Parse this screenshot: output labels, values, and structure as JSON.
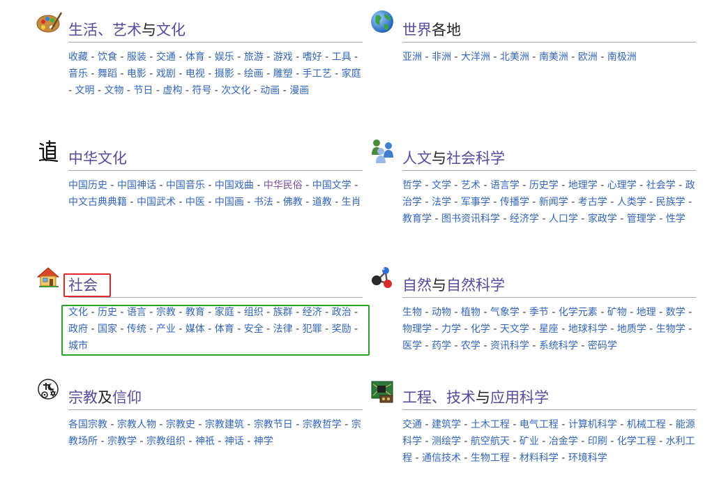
{
  "portals": [
    {
      "id": "arts",
      "icon": "palette-icon",
      "title": [
        "生活、艺术",
        "与",
        "文化"
      ],
      "links": [
        "收藏",
        "饮食",
        "服装",
        "交通",
        "体育",
        "娱乐",
        "旅游",
        "游戏",
        "嗜好",
        "工具",
        "音乐",
        "舞蹈",
        "电影",
        "戏剧",
        "电视",
        "摄影",
        "绘画",
        "雕塑",
        "手工艺",
        "家庭",
        "文明",
        "文物",
        "节日",
        "虚构",
        "符号",
        "次文化",
        "动画",
        "漫画"
      ]
    },
    {
      "id": "world",
      "icon": "globe-icon",
      "title": [
        "世界",
        "各地",
        ""
      ],
      "links": [
        "亚洲",
        "非洲",
        "大洋洲",
        "北美洲",
        "南美洲",
        "欧洲",
        "南极洲"
      ]
    },
    {
      "id": "chinese",
      "icon": "chinese-character-icon",
      "title": [
        "中华文化",
        "",
        ""
      ],
      "links": [
        "中国历史",
        "中国神话",
        "中国音乐",
        "中国戏曲",
        "中华民俗",
        "中国文学",
        "中文古典典籍",
        "中国武术",
        "中医",
        "中国画",
        "书法",
        "佛教",
        "道教",
        "生肖"
      ]
    },
    {
      "id": "humanities",
      "icon": "people-icon",
      "title": [
        "人文",
        "与",
        "社会科学"
      ],
      "links": [
        "哲学",
        "文学",
        "艺术",
        "语言学",
        "历史学",
        "地理学",
        "心理学",
        "社会学",
        "政治学",
        "法学",
        "军事学",
        "传播学",
        "新闻学",
        "考古学",
        "人类学",
        "民族学",
        "教育学",
        "图书资讯科学",
        "经济学",
        "人口学",
        "家政学",
        "管理学",
        "性学"
      ]
    },
    {
      "id": "society",
      "icon": "house-icon",
      "title": [
        "社会",
        "",
        ""
      ],
      "links": [
        "文化",
        "历史",
        "语言",
        "宗教",
        "教育",
        "家庭",
        "组织",
        "族群",
        "经济",
        "政治",
        "政府",
        "国家",
        "传统",
        "产业",
        "媒体",
        "体育",
        "安全",
        "法律",
        "犯罪",
        "奖励",
        "城市"
      ]
    },
    {
      "id": "science",
      "icon": "molecule-icon",
      "title": [
        "自然",
        "与",
        "自然科学"
      ],
      "links": [
        "生物",
        "动物",
        "植物",
        "气象学",
        "季节",
        "化学元素",
        "矿物",
        "地理",
        "数学",
        "物理学",
        "力学",
        "化学",
        "天文学",
        "星座",
        "地球科学",
        "地质学",
        "生物学",
        "医学",
        "药学",
        "农学",
        "资讯科学",
        "系统科学",
        "密码学"
      ]
    },
    {
      "id": "religion",
      "icon": "religion-symbols-icon",
      "title": [
        "宗教",
        "及",
        "信仰"
      ],
      "links": [
        "各国宗教",
        "宗教人物",
        "宗教史",
        "宗教建筑",
        "宗教节日",
        "宗教哲学",
        "宗教场所",
        "宗教学",
        "宗教组织",
        "神祇",
        "神话",
        "神学"
      ]
    },
    {
      "id": "engineering",
      "icon": "circuit-board-icon",
      "title": [
        "工程、技术",
        "与",
        "应用科学"
      ],
      "links": [
        "交通",
        "建筑学",
        "土木工程",
        "电气工程",
        "计算机科学",
        "机械工程",
        "能源科学",
        "测绘学",
        "航空航天",
        "矿业",
        "冶金学",
        "印刷",
        "化学工程",
        "水利工程",
        "通信技术",
        "生物工程",
        "材料科学",
        "环境科学"
      ]
    }
  ]
}
